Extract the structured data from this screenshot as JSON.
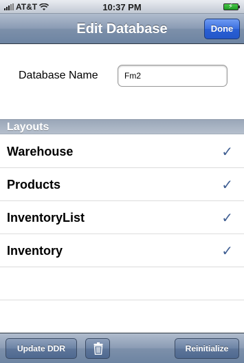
{
  "status_bar": {
    "carrier": "AT&T",
    "time": "10:37 PM",
    "wifi_icon": "wifi-icon",
    "battery_icon": "battery-charging-icon"
  },
  "nav": {
    "title": "Edit Database",
    "done_label": "Done"
  },
  "form": {
    "db_name_label": "Database Name",
    "db_name_value": "Fm2"
  },
  "section": {
    "title": "Layouts"
  },
  "layouts": [
    {
      "label": "Warehouse",
      "checked": true
    },
    {
      "label": "Products",
      "checked": true
    },
    {
      "label": "InventoryList",
      "checked": true
    },
    {
      "label": "Inventory",
      "checked": true
    }
  ],
  "toolbar": {
    "update_label": "Update DDR",
    "trash_icon": "trash-icon",
    "reinit_label": "Reinitialize"
  },
  "colors": {
    "checkmark": "#3f5e92",
    "nav_bar": "#7d90aa",
    "done_button": "#2a5fd4"
  }
}
